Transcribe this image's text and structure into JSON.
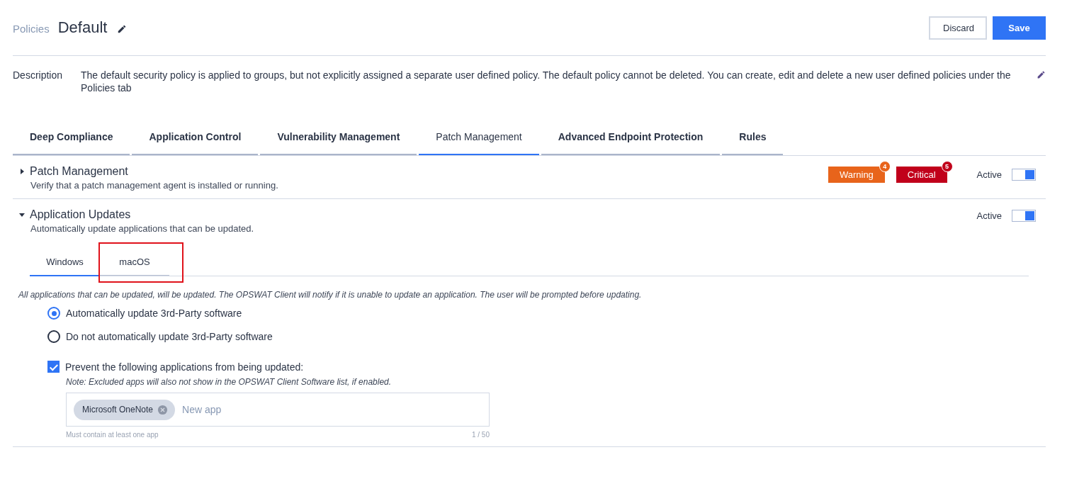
{
  "breadcrumb": "Policies",
  "title": "Default",
  "buttons": [
    {
      "label": "Discard",
      "kind": "secondary"
    },
    {
      "label": "Save",
      "kind": "primary"
    }
  ],
  "description": {
    "label": "Description",
    "text": "The default security policy is applied to groups, but not explicitly assigned a separate user defined policy. The default policy cannot be deleted. You can create, edit and delete a new user defined policies under the Policies tab"
  },
  "tabs": [
    {
      "label": "Deep Compliance",
      "selected": false
    },
    {
      "label": "Application Control",
      "selected": false
    },
    {
      "label": "Vulnerability Management",
      "selected": false
    },
    {
      "label": "Patch Management",
      "selected": true
    },
    {
      "label": "Advanced Endpoint Protection",
      "selected": false
    },
    {
      "label": "Rules",
      "selected": false
    }
  ],
  "sections": [
    {
      "title": "Patch Management",
      "subtitle": "Verify that a patch management agent is installed or running.",
      "expanded": false,
      "active_label": "Active",
      "active": true,
      "badges": [
        {
          "label": "Warning",
          "count": "4",
          "color": "#e8641b"
        },
        {
          "label": "Critical",
          "count": "5",
          "color": "#c1001b"
        }
      ]
    },
    {
      "title": "Application Updates",
      "subtitle": "Automatically update applications that can be updated.",
      "expanded": true,
      "active_label": "Active",
      "active": true,
      "os_tabs": [
        {
          "label": "Windows",
          "selected": true,
          "highlighted": false
        },
        {
          "label": "macOS",
          "selected": false,
          "highlighted": true
        }
      ],
      "info": "All applications that can be updated, will be updated. The OPSWAT Client will notify if it is unable to update an application. The user will be prompted before updating.",
      "radios": [
        {
          "label": "Automatically update 3rd-Party software",
          "selected": true
        },
        {
          "label": "Do not automatically update 3rd-Party software",
          "selected": false
        }
      ],
      "exclude": {
        "label": "Prevent the following applications from being updated:",
        "checked": true,
        "note": "Note: Excluded apps will also not show in the OPSWAT Client Software list, if enabled.",
        "chips": [
          "Microsoft OneNote"
        ],
        "placeholder": "New app",
        "hint": "Must contain at least one app",
        "counter": "1 / 50"
      }
    }
  ]
}
